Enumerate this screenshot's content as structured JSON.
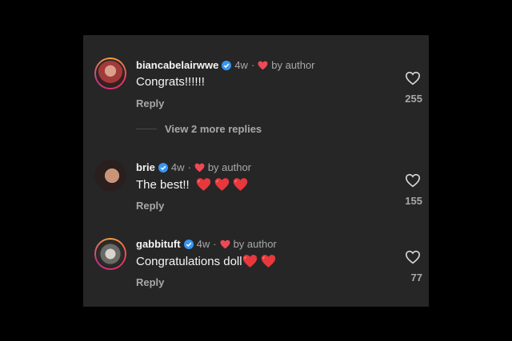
{
  "colors": {
    "background": "#000000",
    "panel": "#262626",
    "text_primary": "#f5f5f5",
    "text_secondary": "#a8a8a8",
    "verified_badge": "#3897f0",
    "heart_red": "#ed4956"
  },
  "comments": [
    {
      "username": "biancabelairwwe",
      "verified": true,
      "time": "4w",
      "author_like_label": "by author",
      "text": "Congrats!!!!!!",
      "emoji": [],
      "reply_label": "Reply",
      "like_count": "255",
      "avatar_ring": true
    },
    {
      "username": "brie",
      "verified": true,
      "time": "4w",
      "author_like_label": "by author",
      "text": "The best!!",
      "emoji": [
        "red-heart",
        "red-heart",
        "red-heart"
      ],
      "reply_label": "Reply",
      "like_count": "155",
      "avatar_ring": false
    },
    {
      "username": "gabbituft",
      "verified": true,
      "time": "4w",
      "author_like_label": "by author",
      "text": "Congratulations doll",
      "emoji": [
        "red-heart",
        "red-heart"
      ],
      "reply_label": "Reply",
      "like_count": "77",
      "avatar_ring": true
    }
  ],
  "view_more_replies": "View 2 more replies",
  "separator": "·"
}
